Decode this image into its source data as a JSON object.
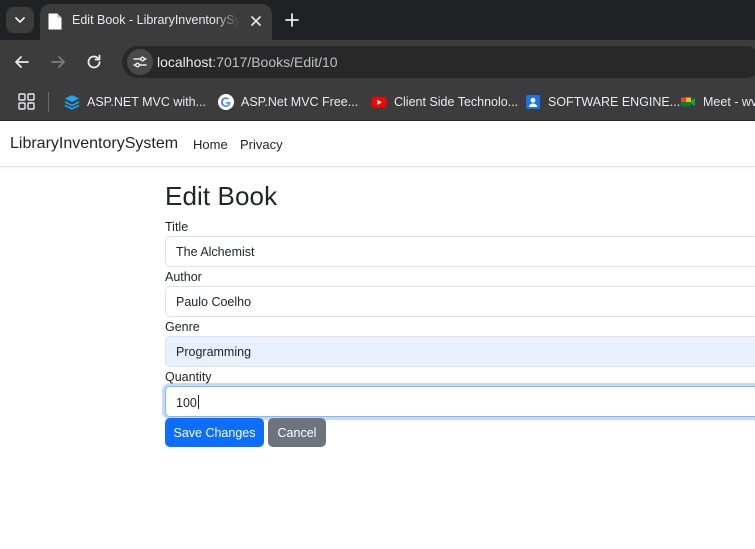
{
  "browser": {
    "tab": {
      "title": "Edit Book - LibraryInventorySystem"
    },
    "address": {
      "host": "localhost",
      "path": ":7017/Books/Edit/10"
    },
    "bookmarks": [
      {
        "label": "ASP.NET MVC with...",
        "icon": "stack-icon",
        "color": "#1ea7fd"
      },
      {
        "label": "ASP.Net MVC Free...",
        "icon": "google-icon",
        "color": "#4285f4"
      },
      {
        "label": "Client Side Technolo...",
        "icon": "youtube-icon",
        "color": "#ff0000"
      },
      {
        "label": "SOFTWARE ENGINE...",
        "icon": "contact-icon",
        "color": "#1a73e8"
      },
      {
        "label": "Meet - wv",
        "icon": "meet-icon",
        "color": "#00832d"
      }
    ]
  },
  "navbar": {
    "brand": "LibraryInventorySystem",
    "links": [
      "Home",
      "Privacy"
    ]
  },
  "form": {
    "heading": "Edit Book",
    "fields": [
      {
        "label": "Title",
        "value": "The Alchemist"
      },
      {
        "label": "Author",
        "value": "Paulo Coelho"
      },
      {
        "label": "Genre",
        "value": "Programming"
      },
      {
        "label": "Quantity",
        "value": "100"
      }
    ],
    "save_label": "Save Changes",
    "cancel_label": "Cancel"
  },
  "colors": {
    "primary": "#0d6efd",
    "secondary": "#6c757d",
    "focus_ring": "#86b7fe",
    "autofill": "#e8f0fe"
  }
}
